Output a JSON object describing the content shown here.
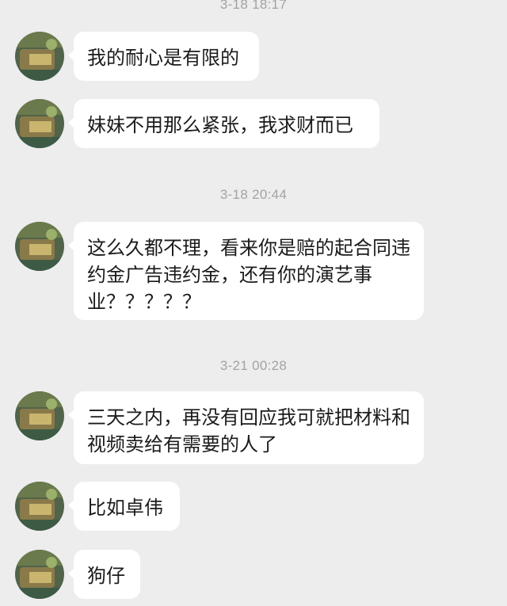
{
  "timestamps": [
    "3-18 18:17",
    "3-18 20:44",
    "3-21 00:28"
  ],
  "messages": [
    {
      "sender": "other",
      "text": "我的耐心是有限的"
    },
    {
      "sender": "other",
      "text": "妹妹不用那么紧张，我求财而已"
    },
    {
      "sender": "other",
      "text": "这么久都不理，看来你是赔的起合同违约金广告违约金，还有你的演艺事业？？？？？"
    },
    {
      "sender": "other",
      "text": "三天之内，再没有回应我可就把材料和视频卖给有需要的人了"
    },
    {
      "sender": "other",
      "text": "比如卓伟"
    },
    {
      "sender": "other",
      "text": "狗仔"
    }
  ],
  "colors": {
    "background": "#ededed",
    "bubble": "#ffffff",
    "timestamp_text": "#a3a3a3",
    "message_text": "#1b1b1b"
  },
  "icons": {
    "avatar": "contact-avatar-icon"
  }
}
